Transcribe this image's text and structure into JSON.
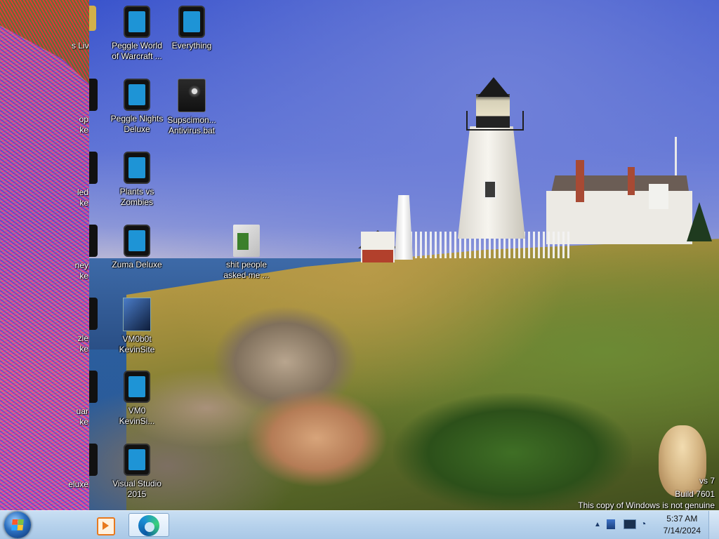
{
  "desktop": {
    "icons": [
      {
        "label": "Peggle World of Warcraft ..."
      },
      {
        "label": "Everything"
      },
      {
        "label": "Peggle Nights Deluxe"
      },
      {
        "label": "Supscimon... Antivirus.bat"
      },
      {
        "label": "Plants vs Zombies"
      },
      {
        "label": "Zuma Deluxe"
      },
      {
        "label": "shit people asked me ..."
      },
      {
        "label": "VM0b0t KevinSite"
      },
      {
        "label": "VM0 KevinSi..."
      },
      {
        "label": "Visual Studio 2015"
      }
    ],
    "partial_icons": [
      {
        "label": "s Live"
      },
      {
        "label": "op ke"
      },
      {
        "label": "led ke"
      },
      {
        "label": "ney ke"
      },
      {
        "label": "zle ke"
      },
      {
        "label": "uar ke"
      },
      {
        "label": "eluxe"
      }
    ]
  },
  "watermark": {
    "line1": "vs 7",
    "line2": "Build 7601",
    "line3": "This copy of Windows is not genuine"
  },
  "taskbar": {
    "start_icon": "windows-start-orb",
    "pinned": [
      {
        "icon": "windows-media-player-icon"
      },
      {
        "icon": "edge-icon"
      }
    ],
    "tray": {
      "icons": [
        "show-hidden-icons",
        "action-center-icon",
        "network-icon",
        "volume-icon"
      ]
    },
    "clock": {
      "time": "5:37 AM",
      "date": "7/14/2024"
    }
  }
}
